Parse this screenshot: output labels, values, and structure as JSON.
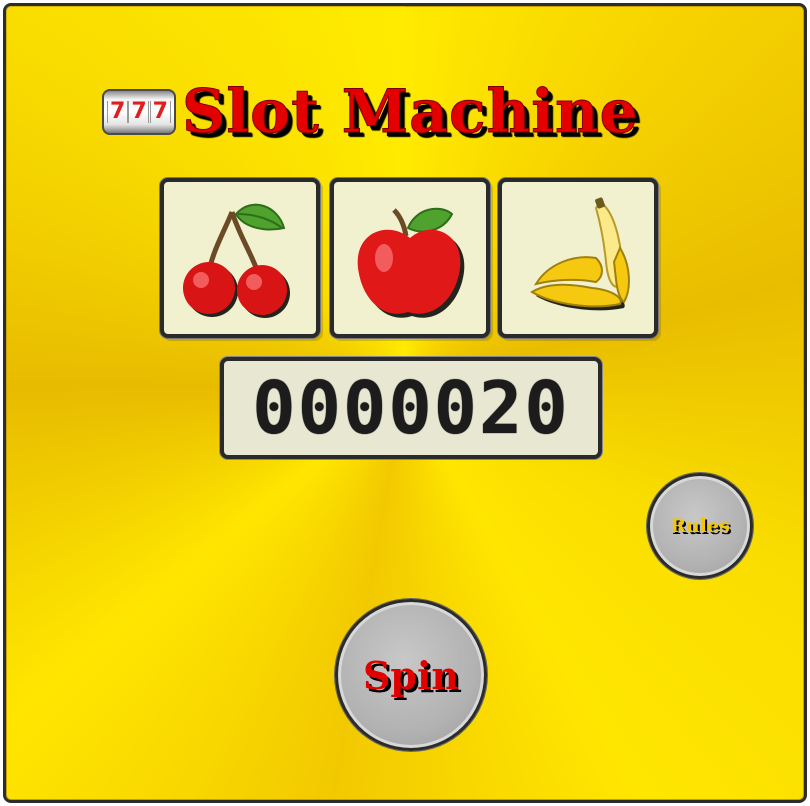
{
  "title": {
    "text": "Slot Machine",
    "icon": "777-reel-icon",
    "icon_digits": [
      "7",
      "7",
      "7"
    ]
  },
  "reels": [
    {
      "symbol": "cherries",
      "icon": "cherries-icon"
    },
    {
      "symbol": "apple",
      "icon": "apple-icon"
    },
    {
      "symbol": "banana",
      "icon": "banana-icon"
    }
  ],
  "counter": {
    "value": "0000020"
  },
  "buttons": {
    "rules": "Rules",
    "spin": "Spin"
  },
  "colors": {
    "background": "#ffe000",
    "title": "#e50000",
    "reel_face": "#f1f1d0",
    "button_face": "#b8b8b8",
    "spin_text": "#e00000",
    "rules_text": "#f3c600"
  }
}
